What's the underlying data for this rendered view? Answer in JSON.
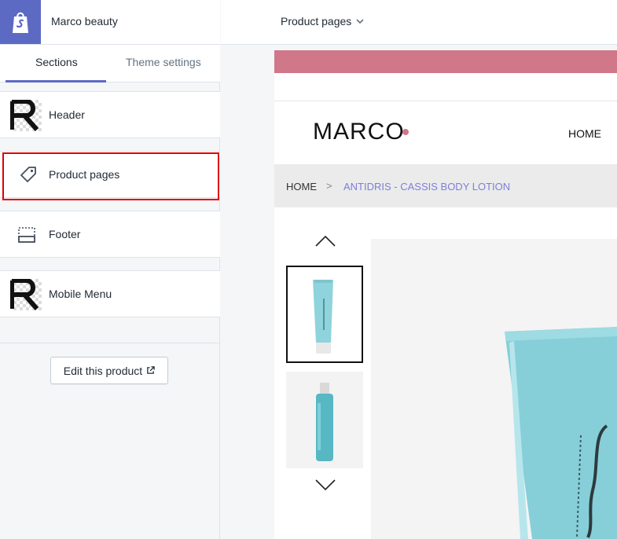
{
  "store": {
    "name": "Marco beauty",
    "logo_icon": "shopify-bag-icon"
  },
  "tabs": {
    "sections": "Sections",
    "theme_settings": "Theme settings"
  },
  "sections": [
    {
      "label": "Header",
      "icon": "image-thumbnail-icon"
    },
    {
      "label": "Product pages",
      "icon": "tag-icon"
    },
    {
      "label": "Footer",
      "icon": "footer-layout-icon"
    },
    {
      "label": "Mobile Menu",
      "icon": "image-thumbnail-icon"
    }
  ],
  "edit_button": {
    "label": "Edit this product",
    "icon": "external-link-icon"
  },
  "topbar": {
    "page_select": "Product pages",
    "chevron": "chevron-down-icon"
  },
  "preview": {
    "brand": "MARCO",
    "nav_home": "HOME",
    "breadcrumb": {
      "home": "HOME",
      "separator": ">",
      "current": "ANTIDRIS - CASSIS BODY LOTION"
    },
    "announcement_color": "#d07789",
    "breadcrumb_link_color": "#7b7fdc"
  },
  "colors": {
    "accent": "#5c6ac4",
    "highlight": "#e00000"
  }
}
